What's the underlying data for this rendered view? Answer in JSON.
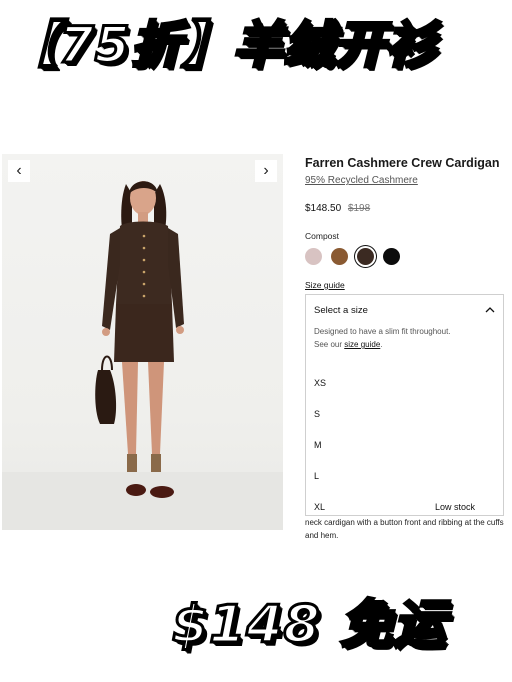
{
  "banner": {
    "top_text": "【75折】羊绒开衫",
    "bottom_text": "$148 免运"
  },
  "product": {
    "name": "Farren Cashmere Crew Cardigan",
    "material": "95% Recycled Cashmere",
    "price_now": "$148.50",
    "price_was": "$198",
    "color_label": "Compost",
    "swatches": [
      {
        "name": "blush",
        "color": "#d8c3c2"
      },
      {
        "name": "camel",
        "color": "#8a5a32"
      },
      {
        "name": "compost",
        "color": "#3b2a22"
      },
      {
        "name": "black",
        "color": "#0c0c0c"
      }
    ],
    "size_guide_link": "Size guide",
    "description": "neck cardigan with a button front and ribbing at the cuffs and hem."
  },
  "gallery": {
    "prev_icon": "‹",
    "next_icon": "›"
  },
  "size_dropdown": {
    "placeholder": "Select a size",
    "chevron": "up",
    "note_line1": "Designed to have a slim fit throughout.",
    "note_prefix": "See our ",
    "note_link": "size guide",
    "note_suffix": ".",
    "sizes": [
      {
        "label": "XS",
        "stock": ""
      },
      {
        "label": "S",
        "stock": ""
      },
      {
        "label": "M",
        "stock": ""
      },
      {
        "label": "L",
        "stock": ""
      },
      {
        "label": "XL",
        "stock": "Low stock"
      }
    ]
  }
}
